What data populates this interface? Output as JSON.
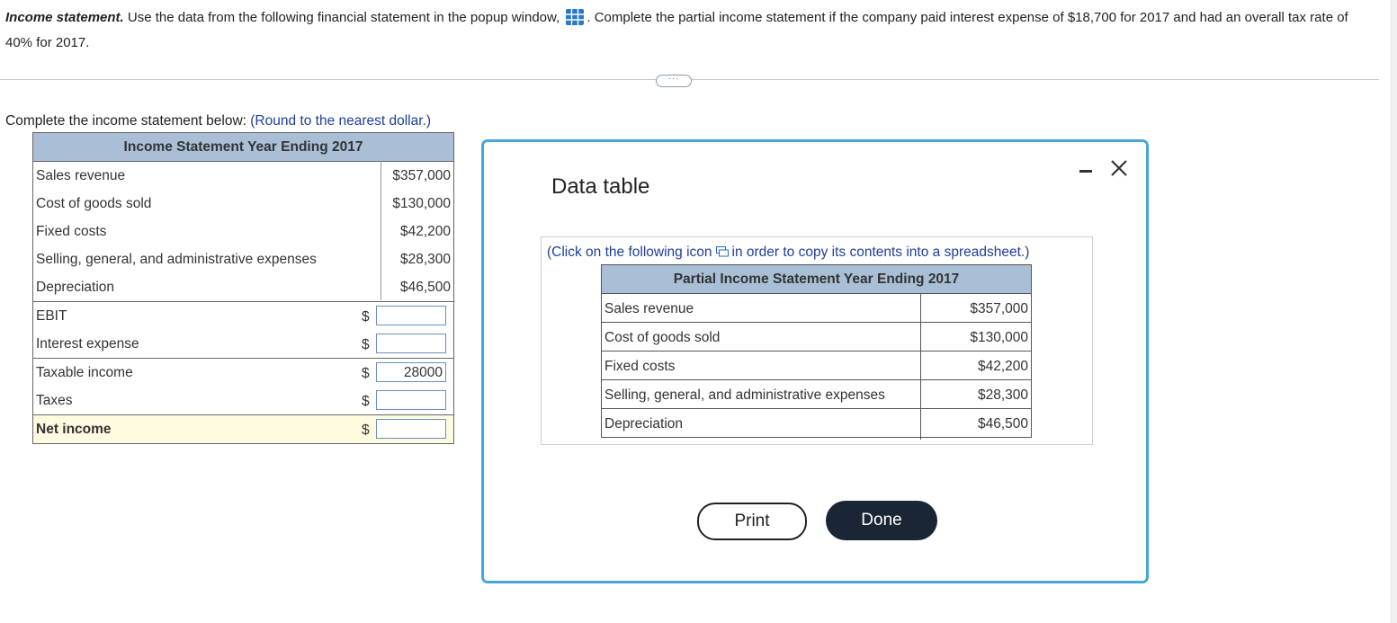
{
  "question": {
    "lead": "Income statement.",
    "part1": "Use the data from the following financial statement in the popup window,",
    "part2": ". Complete the partial income statement if the company paid interest expense of $18,700 for 2017 and had an overall tax rate of 40% for 2017."
  },
  "more_label": "···",
  "instruction": {
    "text": "Complete the income statement below:",
    "hint": "(Round to the nearest dollar.)"
  },
  "income_statement": {
    "title": "Income Statement Year Ending 2017",
    "given": [
      {
        "label": "Sales revenue",
        "value": "$357,000"
      },
      {
        "label": "Cost of goods sold",
        "value": "$130,000"
      },
      {
        "label": "Fixed costs",
        "value": "$42,200"
      },
      {
        "label": "Selling, general, and administrative expenses",
        "value": "$28,300"
      },
      {
        "label": "Depreciation",
        "value": "$46,500"
      }
    ],
    "currency": "$",
    "inputs": [
      {
        "label": "EBIT",
        "value": ""
      },
      {
        "label": "Interest expense",
        "value": ""
      },
      {
        "label": "Taxable income",
        "value": "28000"
      },
      {
        "label": "Taxes",
        "value": ""
      },
      {
        "label": "Net income",
        "value": ""
      }
    ]
  },
  "popup": {
    "title": "Data table",
    "note_before": "(Click on the following icon",
    "note_after": "in order to copy its contents into a spreadsheet.)",
    "table_title": "Partial Income Statement Year Ending 2017",
    "rows": [
      {
        "label": "Sales revenue",
        "value": "$357,000"
      },
      {
        "label": "Cost of goods sold",
        "value": "$130,000"
      },
      {
        "label": "Fixed costs",
        "value": "$42,200"
      },
      {
        "label": "Selling, general, and administrative expenses",
        "value": "$28,300"
      },
      {
        "label": "Depreciation",
        "value": "$46,500"
      }
    ],
    "print_label": "Print",
    "done_label": "Done"
  },
  "colors": {
    "header_blue": "#a9bfd6",
    "hint_blue": "#1f3f99",
    "popup_border": "#46a6d8",
    "done_bg": "#1a2636",
    "net_income_bg": "#fefbe0"
  }
}
